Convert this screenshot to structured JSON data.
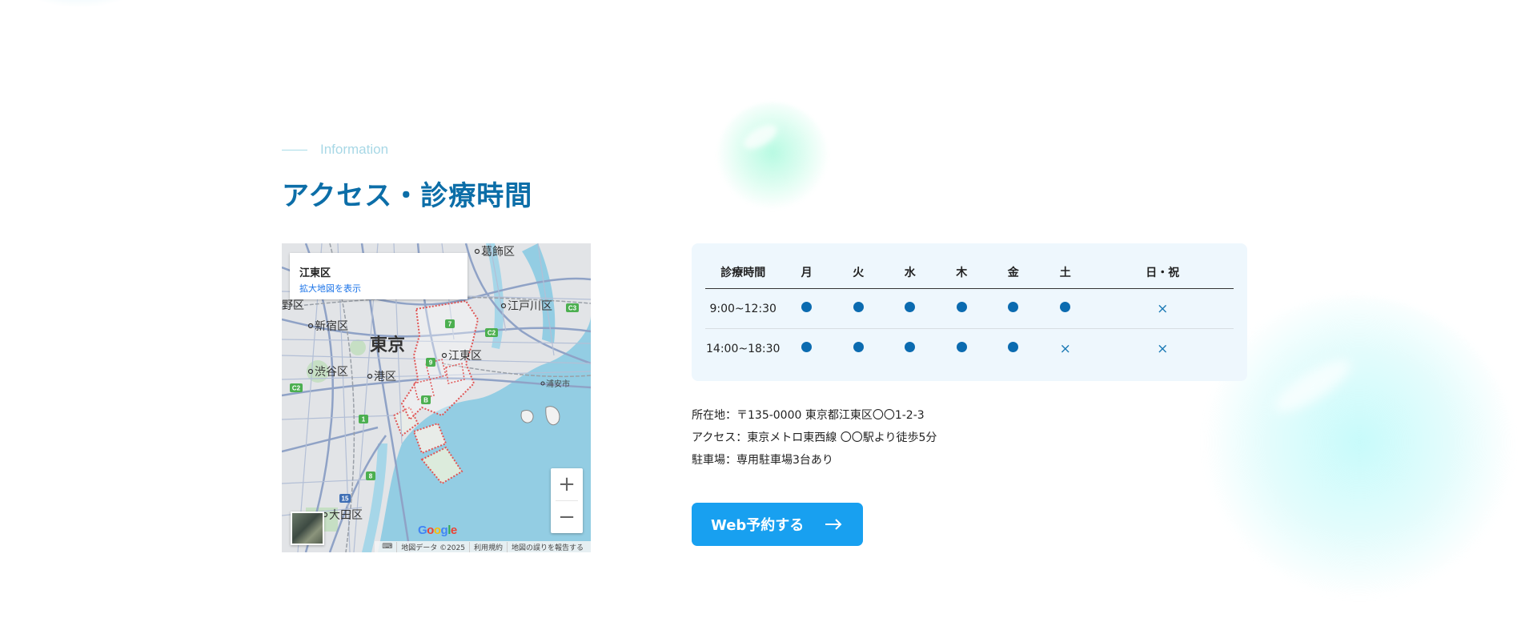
{
  "section": {
    "eyebrow": "Information",
    "title": "アクセス・診療時間"
  },
  "map": {
    "card_title": "江東区",
    "card_link": "拡大地図を表示",
    "labels": {
      "tokyo": "東京",
      "koto_ku": "江東区",
      "shinjuku_ku": "新宿区",
      "shibuya_ku": "渋谷区",
      "minato_ku": "港区",
      "katsushika_ku": "葛飾区",
      "edogawa_ku": "江戸川区",
      "ota_ku": "大田区",
      "nakano_ku": "野区",
      "urayasu": "浦安市"
    },
    "route_badges": [
      "7",
      "9",
      "C2",
      "C2",
      "1",
      "B",
      "8",
      "15",
      "C3"
    ],
    "google_logo": "Google",
    "attribution": [
      "地図データ ©2025",
      "利用規約",
      "地図の誤りを報告する"
    ],
    "zoom_in": "+",
    "zoom_out": "−"
  },
  "hours": {
    "headers": [
      "診療時間",
      "月",
      "火",
      "水",
      "木",
      "金",
      "土",
      "日・祝"
    ],
    "rows": [
      {
        "time": "9:00~12:30",
        "days": [
          "open",
          "open",
          "open",
          "open",
          "open",
          "open",
          "closed"
        ]
      },
      {
        "time": "14:00~18:30",
        "days": [
          "open",
          "open",
          "open",
          "open",
          "open",
          "closed",
          "closed"
        ]
      }
    ],
    "closed_mark": "×",
    "colors": {
      "open": "#0b6bb0",
      "closed": "#1a79b5"
    }
  },
  "info": {
    "address": "所在地：〒135-0000 東京都江東区〇〇1-2-3",
    "access": "アクセス：東京メトロ東西線 〇〇駅より徒歩5分",
    "parking": "駐車場：専用駐車場3台あり"
  },
  "cta": {
    "label": "Web予約する",
    "icon": "arrow-right-icon",
    "color": "#18a0f0"
  },
  "colors": {
    "title": "#0c6ea8",
    "eyebrow": "#a8d8e6",
    "table_bg": "#eef7fd"
  }
}
